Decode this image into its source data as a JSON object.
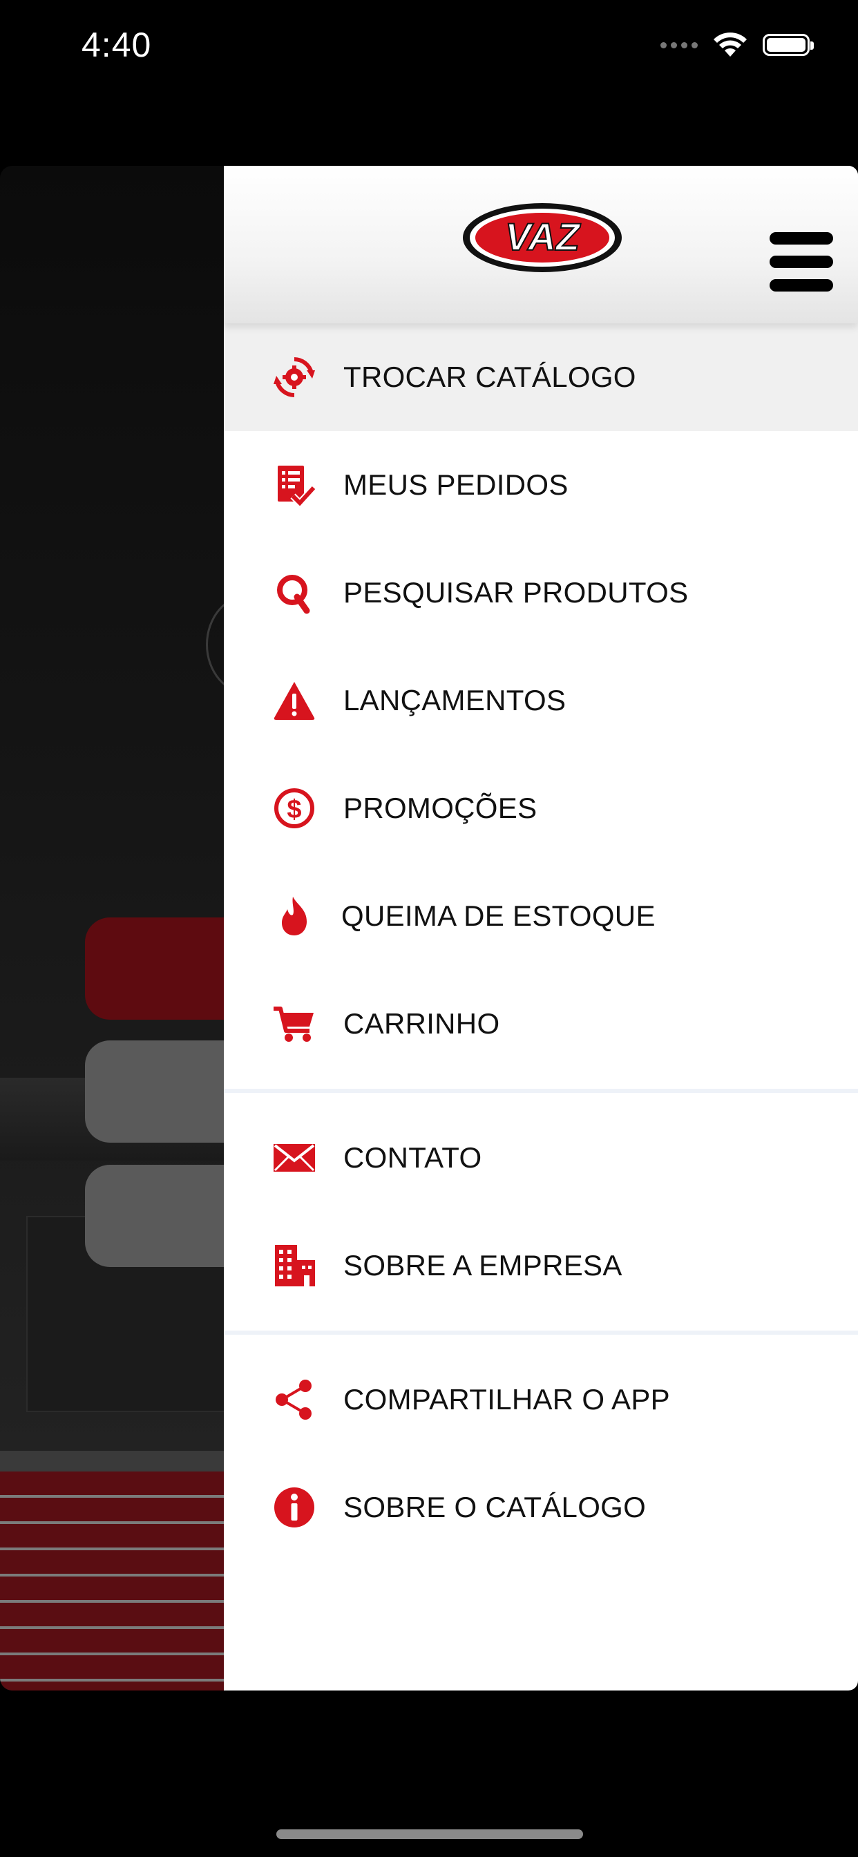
{
  "status_bar": {
    "time": "4:40"
  },
  "header": {
    "logo_text": "VAZ"
  },
  "menu_primary": [
    {
      "label": "TROCAR CATÁLOGO",
      "icon": "catalog-swap-gear-icon"
    },
    {
      "label": "MEUS PEDIDOS",
      "icon": "orders-checklist-icon"
    },
    {
      "label": "PESQUISAR PRODUTOS",
      "icon": "search-q-icon"
    },
    {
      "label": "LANÇAMENTOS",
      "icon": "warning-icon"
    },
    {
      "label": "PROMOÇÕES",
      "icon": "dollar-circle-icon"
    },
    {
      "label": "QUEIMA DE ESTOQUE",
      "icon": "fire-icon"
    },
    {
      "label": "CARRINHO",
      "icon": "cart-icon"
    }
  ],
  "menu_company": [
    {
      "label": "CONTATO",
      "icon": "mail-icon"
    },
    {
      "label": "SOBRE A EMPRESA",
      "icon": "building-icon"
    }
  ],
  "menu_app": [
    {
      "label": "COMPARTILHAR O APP",
      "icon": "share-icon"
    },
    {
      "label": "SOBRE O CATÁLOGO",
      "icon": "info-icon"
    }
  ],
  "colors": {
    "accent": "#d7141e",
    "text": "#111111",
    "active_row": "#f0f0f0"
  }
}
